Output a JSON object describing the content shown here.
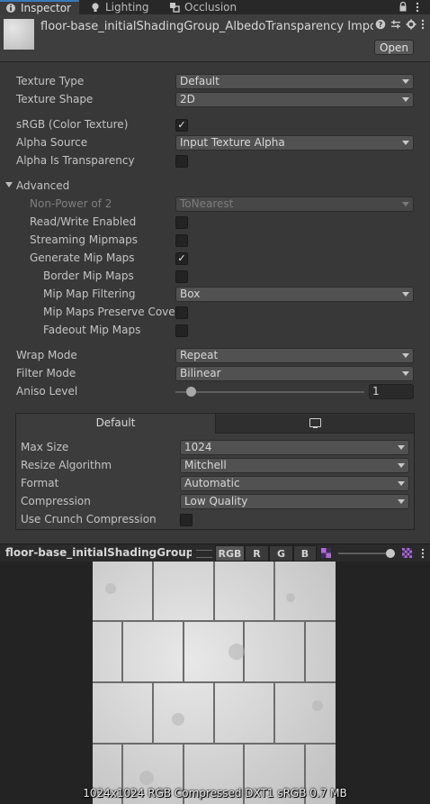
{
  "tabs": [
    {
      "label": "Inspector",
      "icon": "info-icon",
      "active": true
    },
    {
      "label": "Lighting",
      "icon": "lightbulb-icon",
      "active": false
    },
    {
      "label": "Occlusion",
      "icon": "occlusion-icon",
      "active": false
    }
  ],
  "header": {
    "asset_title": "floor-base_initialShadingGroup_AlbedoTransparency Impor",
    "open_label": "Open"
  },
  "settings": {
    "texture_type": {
      "label": "Texture Type",
      "value": "Default"
    },
    "texture_shape": {
      "label": "Texture Shape",
      "value": "2D"
    },
    "srgb": {
      "label": "sRGB (Color Texture)",
      "checked": true
    },
    "alpha_source": {
      "label": "Alpha Source",
      "value": "Input Texture Alpha"
    },
    "alpha_is_transparency": {
      "label": "Alpha Is Transparency",
      "checked": false
    },
    "advanced_label": "Advanced",
    "non_power_of_2": {
      "label": "Non-Power of 2",
      "value": "ToNearest"
    },
    "read_write": {
      "label": "Read/Write Enabled",
      "checked": false
    },
    "streaming_mipmaps": {
      "label": "Streaming Mipmaps",
      "checked": false
    },
    "generate_mip_maps": {
      "label": "Generate Mip Maps",
      "checked": true
    },
    "border_mip_maps": {
      "label": "Border Mip Maps",
      "checked": false
    },
    "mip_map_filtering": {
      "label": "Mip Map Filtering",
      "value": "Box"
    },
    "mip_maps_preserve_coverage": {
      "label": "Mip Maps Preserve Cover",
      "checked": false
    },
    "fadeout_mip_maps": {
      "label": "Fadeout Mip Maps",
      "checked": false
    },
    "wrap_mode": {
      "label": "Wrap Mode",
      "value": "Repeat"
    },
    "filter_mode": {
      "label": "Filter Mode",
      "value": "Bilinear"
    },
    "aniso_level": {
      "label": "Aniso Level",
      "value": "1",
      "level": 1,
      "min": 0,
      "max": 16
    }
  },
  "platform": {
    "default_tab": "Default",
    "max_size": {
      "label": "Max Size",
      "value": "1024"
    },
    "resize_algorithm": {
      "label": "Resize Algorithm",
      "value": "Mitchell"
    },
    "format": {
      "label": "Format",
      "value": "Automatic"
    },
    "compression": {
      "label": "Compression",
      "value": "Low Quality"
    },
    "use_crunch": {
      "label": "Use Crunch Compression",
      "checked": false
    }
  },
  "preview": {
    "name": "floor-base_initialShadingGroup_Alb",
    "channels": [
      "RGB",
      "R",
      "G",
      "B"
    ],
    "selected_channel": "RGB",
    "info": "1024x1024  RGB Compressed DXT1 sRGB   0.7 MB"
  },
  "colors": {
    "background": "#383838",
    "tab_accent": "#3a79bb",
    "texture_tile": "#d4d4d4",
    "texture_grout": "#6c6c6c"
  }
}
